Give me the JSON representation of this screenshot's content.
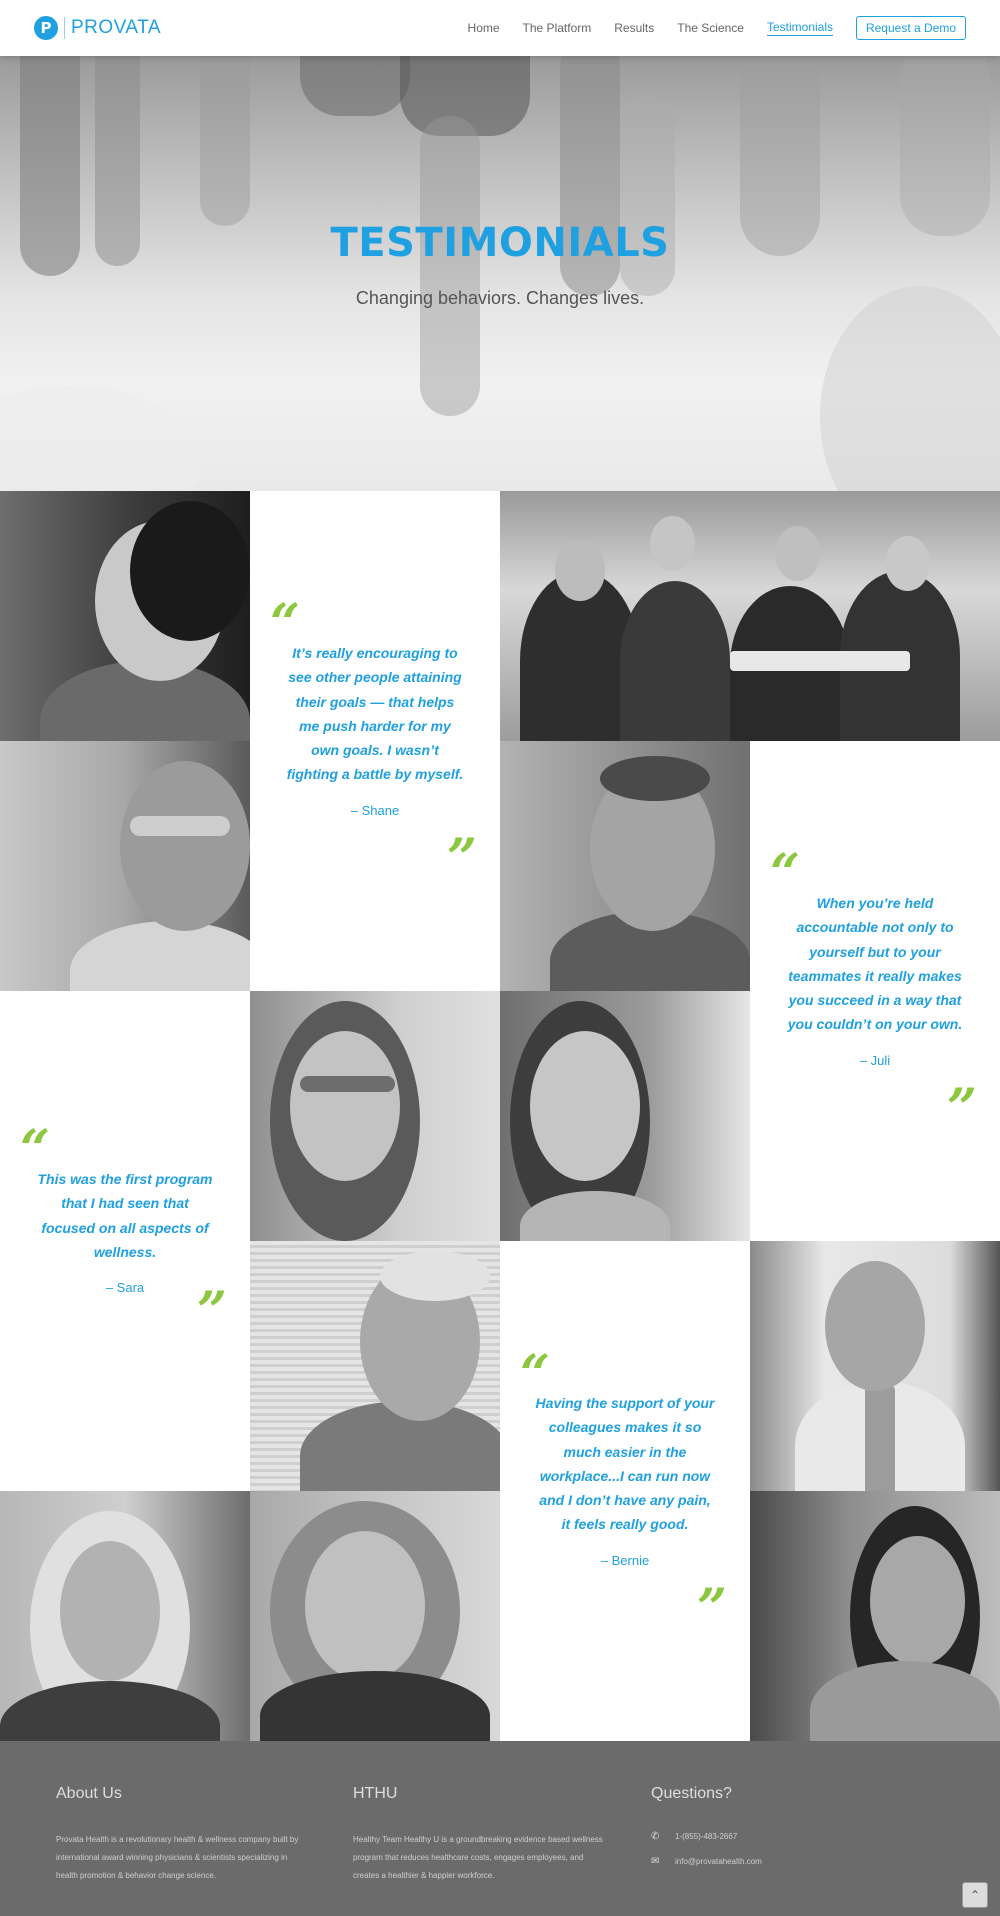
{
  "brand": {
    "logo_letter": "P",
    "name": "PROVATA",
    "color": "#1fa0e0"
  },
  "nav": {
    "items": [
      {
        "label": "Home"
      },
      {
        "label": "The Platform"
      },
      {
        "label": "Results"
      },
      {
        "label": "The Science"
      },
      {
        "label": "Testimonials",
        "active": true
      }
    ],
    "cta": "Request a Demo"
  },
  "hero": {
    "title": "TESTIMONIALS",
    "subtitle": "Changing behaviors. Changes lives."
  },
  "quotes": [
    {
      "open": "“",
      "close": "”",
      "text": "It’s really encouraging to see other people attaining their goals — that helps me push harder for my own goals. I wasn’t fighting a battle by myself.",
      "author": "– Shane"
    },
    {
      "open": "“",
      "close": "”",
      "text": "When you’re held accountable not only to yourself but to your teammates it really makes you succeed in a way that you couldn’t on your own.",
      "author": "– Juli"
    },
    {
      "open": "“",
      "close": "”",
      "text": "This was the first program that I had seen that focused on all aspects of wellness.",
      "author": "– Sara"
    },
    {
      "open": "“",
      "close": "”",
      "text": "Having the support of your colleagues makes it so much easier in the workplace...I can run now and I don’t have any pain, it feels really good.",
      "author": "– Bernie"
    }
  ],
  "footer": {
    "about": {
      "title": "About Us",
      "text": "Provata Health is a revolutionary health & wellness company built by international award winning physicians & scientists specializing in health promotion & behavior change science."
    },
    "hthu": {
      "title": "HTHU",
      "text": "Healthy Team Healthy U is a groundbreaking evidence based wellness program that reduces healthcare costs, engages employees, and creates a healthier & happier workforce."
    },
    "questions": {
      "title": "Questions?",
      "phone": "1-(855)-483-2667",
      "email": "info@provatahealth.com"
    },
    "to_top": "⌃"
  },
  "colors": {
    "accent": "#1fa0e0",
    "quote_mark": "#8dc63f",
    "footer_bg": "#6b6b6b"
  }
}
